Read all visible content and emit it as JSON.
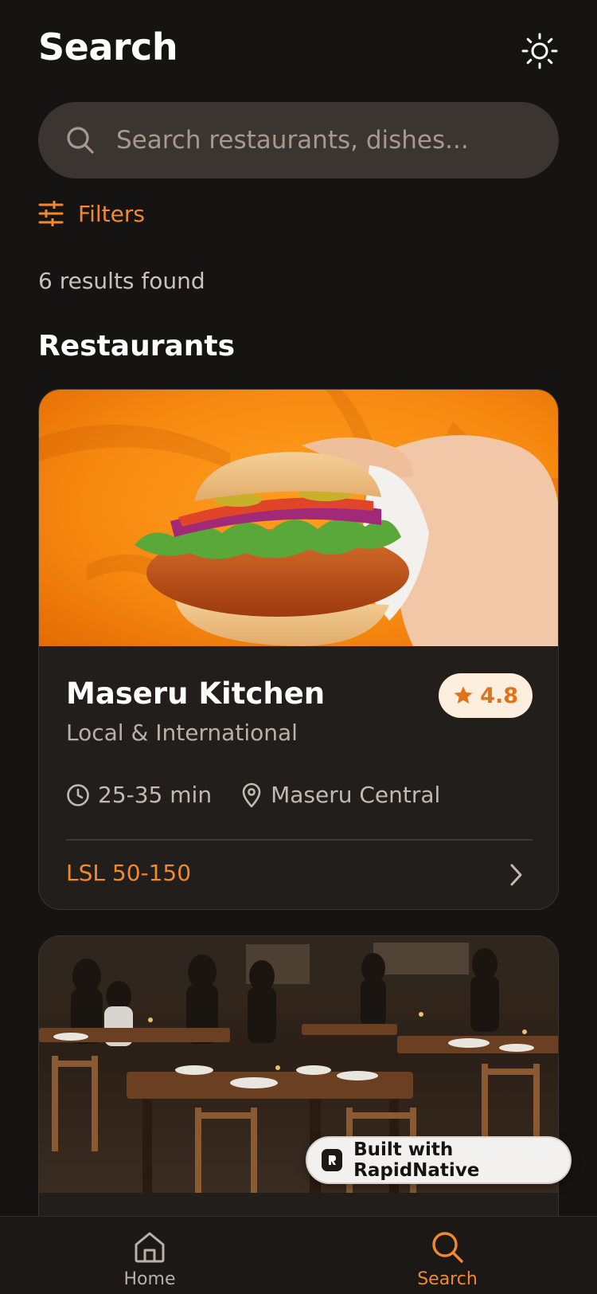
{
  "header": {
    "title": "Search",
    "theme_icon": "sun-icon"
  },
  "search": {
    "placeholder": "Search restaurants, dishes...",
    "value": "",
    "icon": "search-icon"
  },
  "filters": {
    "label": "Filters",
    "icon": "sliders-icon"
  },
  "results": {
    "count_text": "6 results found"
  },
  "sections": {
    "restaurants_title": "Restaurants"
  },
  "restaurants": [
    {
      "name": "Maseru Kitchen",
      "cuisine": "Local & International",
      "rating": "4.8",
      "delivery_time": "25-35 min",
      "location": "Maseru Central",
      "price_range": "LSL 50-150",
      "image": "burger-photo"
    },
    {
      "image": "restaurant-dining-room-photo"
    }
  ],
  "badge": {
    "text": "Built with RapidNative"
  },
  "bottom_nav": {
    "items": [
      {
        "label": "Home",
        "icon": "home-icon",
        "active": false
      },
      {
        "label": "Search",
        "icon": "search-icon",
        "active": true
      }
    ]
  },
  "colors": {
    "background": "#161412",
    "card": "#221e1b",
    "accent": "#f2892d",
    "rating_badge_bg": "#fdeedd",
    "search_bg": "#3a3531"
  }
}
